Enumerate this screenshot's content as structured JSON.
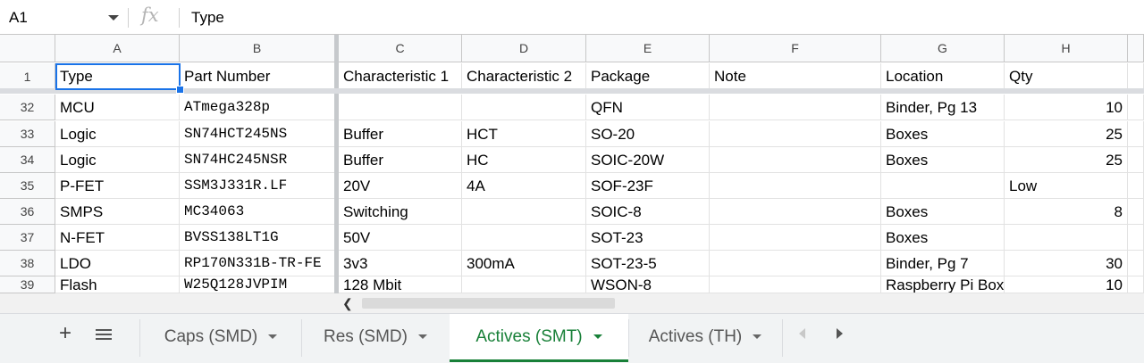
{
  "formula_bar": {
    "cell_ref": "A1",
    "fx": "fx",
    "value": "Type"
  },
  "columns": [
    "A",
    "B",
    "C",
    "D",
    "E",
    "F",
    "G",
    "H"
  ],
  "header_row": {
    "num": "1",
    "cells": [
      "Type",
      "Part Number",
      "Characteristic 1",
      "Characteristic 2",
      "Package",
      "Note",
      "Location",
      "Qty"
    ]
  },
  "rows": [
    {
      "num": "32",
      "cells": [
        "MCU",
        "ATmega328p",
        "",
        "",
        "QFN",
        "",
        "Binder, Pg 13",
        "10"
      ]
    },
    {
      "num": "33",
      "cells": [
        "Logic",
        "SN74HCT245NS",
        "Buffer",
        "HCT",
        "SO-20",
        "",
        "Boxes",
        "25"
      ]
    },
    {
      "num": "34",
      "cells": [
        "Logic",
        "SN74HC245NSR",
        "Buffer",
        "HC",
        "SOIC-20W",
        "",
        "Boxes",
        "25"
      ]
    },
    {
      "num": "35",
      "cells": [
        "P-FET",
        "SSM3J331R.LF",
        "20V",
        "4A",
        "SOF-23F",
        "",
        "",
        "Low"
      ]
    },
    {
      "num": "36",
      "cells": [
        "SMPS",
        "MC34063",
        "Switching",
        "",
        "SOIC-8",
        "",
        "Boxes",
        "8"
      ]
    },
    {
      "num": "37",
      "cells": [
        "N-FET",
        "BVSS138LT1G",
        "50V",
        "",
        "SOT-23",
        "",
        "Boxes",
        ""
      ]
    },
    {
      "num": "38",
      "cells": [
        "LDO",
        "RP170N331B-TR-FE",
        "3v3",
        "300mA",
        "SOT-23-5",
        "",
        "Binder, Pg 7",
        "30"
      ]
    },
    {
      "num": "39",
      "cells": [
        "Flash",
        "W25Q128JVPIM",
        "128 Mbit",
        "",
        "WSON-8",
        "",
        "Raspberry Pi Box",
        "10"
      ]
    }
  ],
  "sheet_tabs": [
    {
      "label": "Caps (SMD)",
      "active": false
    },
    {
      "label": "Res (SMD)",
      "active": false
    },
    {
      "label": "Actives (SMT)",
      "active": true
    },
    {
      "label": "Actives (TH)",
      "active": false
    }
  ],
  "colors": {
    "accent": "#1a73e8",
    "active_tab": "#188038"
  }
}
